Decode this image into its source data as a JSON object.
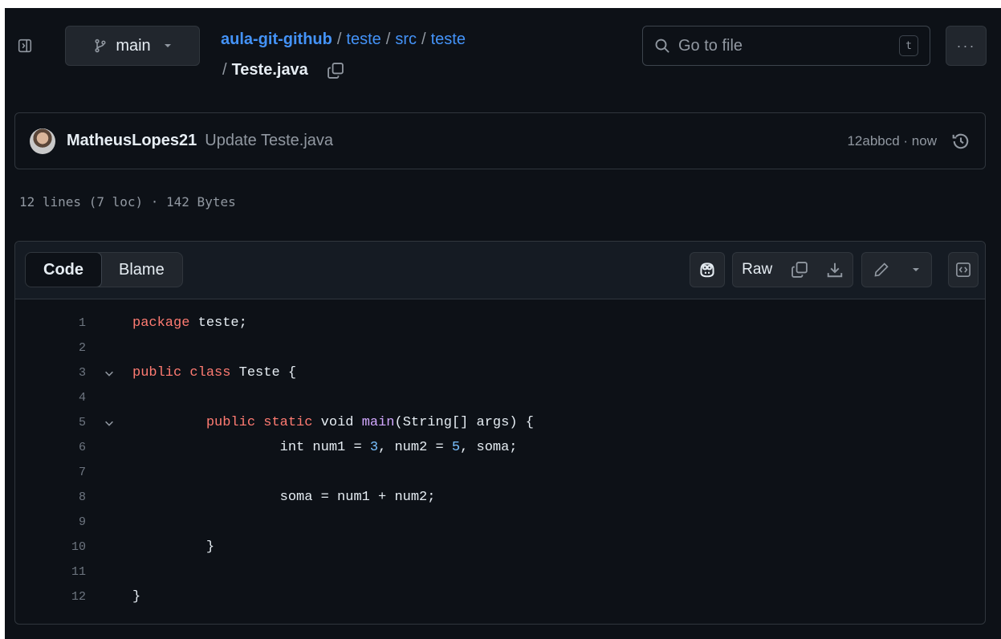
{
  "header": {
    "branch": "main",
    "breadcrumb": {
      "repo": "aula-git-github",
      "dirs": [
        "teste",
        "src",
        "teste"
      ],
      "file": "Teste.java"
    },
    "search": {
      "placeholder": "Go to file",
      "shortcut": "t"
    },
    "more_label": "···"
  },
  "commit": {
    "author": "MatheusLopes21",
    "message": "Update Teste.java",
    "meta": "12abbcd · now"
  },
  "file_info": "12 lines (7 loc) · 142 Bytes",
  "toolbar": {
    "tabs": [
      "Code",
      "Blame"
    ],
    "active_tab": "Code",
    "raw_label": "Raw"
  },
  "code": {
    "lines": [
      {
        "n": "1",
        "fold": false
      },
      {
        "n": "2",
        "fold": false
      },
      {
        "n": "3",
        "fold": true
      },
      {
        "n": "4",
        "fold": false
      },
      {
        "n": "5",
        "fold": true
      },
      {
        "n": "6",
        "fold": false
      },
      {
        "n": "7",
        "fold": false
      },
      {
        "n": "8",
        "fold": false
      },
      {
        "n": "9",
        "fold": false
      },
      {
        "n": "10",
        "fold": false
      },
      {
        "n": "11",
        "fold": false
      },
      {
        "n": "12",
        "fold": false
      }
    ],
    "tokens": {
      "l1_kw": "package",
      "l1_rest": " teste;",
      "l3_kw1": "public",
      "l3_kw2": "class",
      "l3_rest": " Teste {",
      "l5_indent": "         ",
      "l5_kw1": "public",
      "l5_kw2": "static",
      "l5_void": " void ",
      "l5_fn": "main",
      "l5_rest": "(String[] args) {",
      "l6_pre": "                  int num1 = ",
      "l6_n1": "3",
      "l6_mid": ", num2 = ",
      "l6_n2": "5",
      "l6_end": ", soma;",
      "l8_text": "                  soma = num1 + num2;",
      "l10_text": "         }",
      "l12_text": "}"
    }
  },
  "colors": {
    "background": "#0d1117",
    "link": "#4493f8",
    "keyword": "#ff7b72",
    "function": "#d2a8ff",
    "number": "#79c0ff"
  }
}
